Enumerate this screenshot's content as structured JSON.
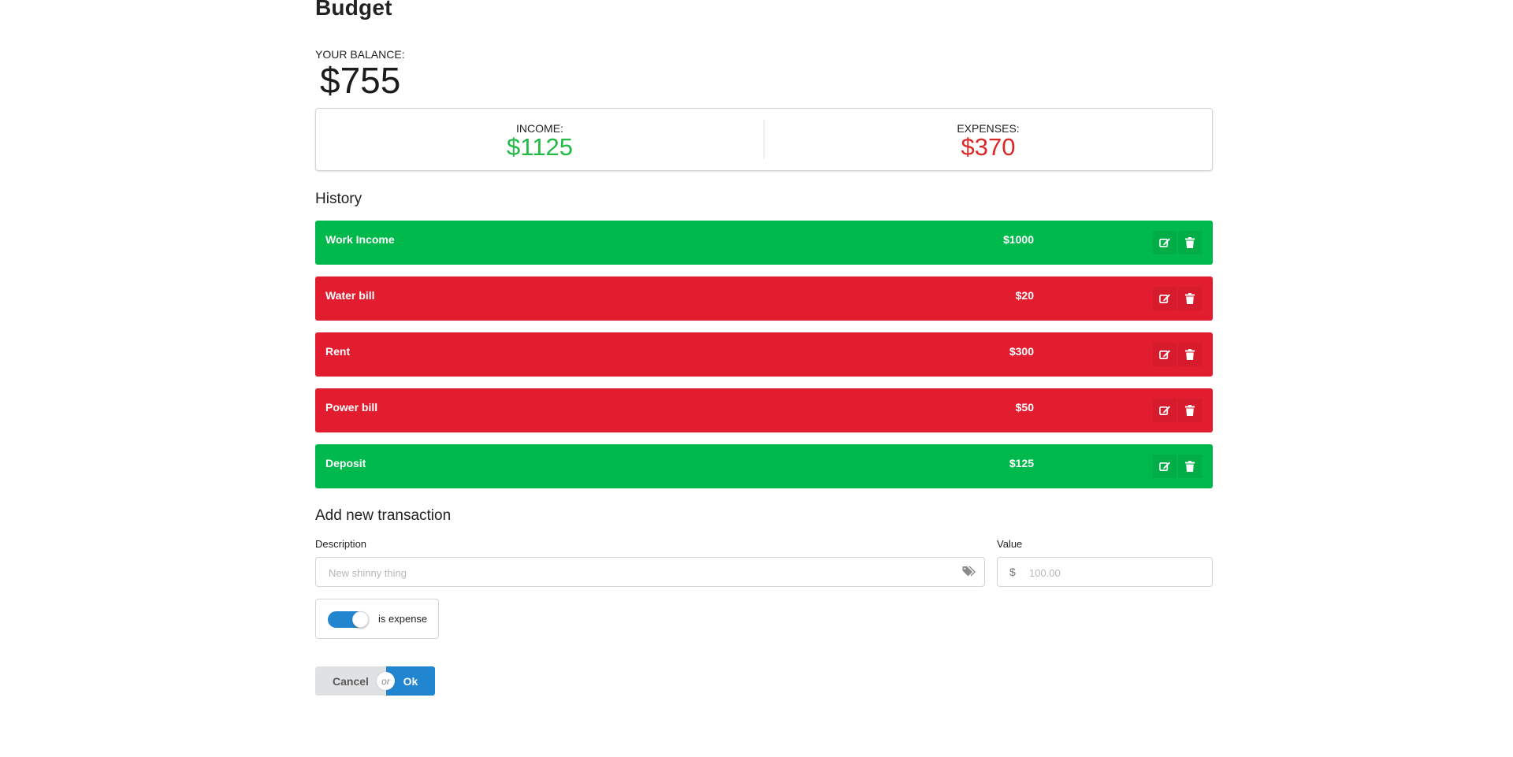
{
  "header": {
    "title": "Budget"
  },
  "balance": {
    "label": "YOUR BALANCE:",
    "value": "$755"
  },
  "summary": {
    "income": {
      "label": "INCOME:",
      "value": "$1125",
      "color": "#21ba45"
    },
    "expenses": {
      "label": "EXPENSES:",
      "value": "$370",
      "color": "#db2828"
    }
  },
  "history": {
    "title": "History",
    "items": [
      {
        "description": "Work Income",
        "amount": "$1000",
        "type": "income"
      },
      {
        "description": "Water bill",
        "amount": "$20",
        "type": "expense"
      },
      {
        "description": "Rent",
        "amount": "$300",
        "type": "expense"
      },
      {
        "description": "Power bill",
        "amount": "$50",
        "type": "expense"
      },
      {
        "description": "Deposit",
        "amount": "$125",
        "type": "income"
      }
    ],
    "icons": {
      "edit": "edit-icon",
      "delete": "trash-icon"
    },
    "colors": {
      "income": "#00b94c",
      "expense": "#e21d30"
    }
  },
  "form": {
    "title": "Add new transaction",
    "description": {
      "label": "Description",
      "placeholder": "New shinny thing",
      "value": "",
      "icon": "tags-icon"
    },
    "value": {
      "label": "Value",
      "prefix": "$",
      "placeholder": "100.00",
      "value": ""
    },
    "toggle": {
      "label": "is expense",
      "checked": true
    },
    "buttons": {
      "cancel": "Cancel",
      "or": "or",
      "ok": "Ok"
    }
  }
}
